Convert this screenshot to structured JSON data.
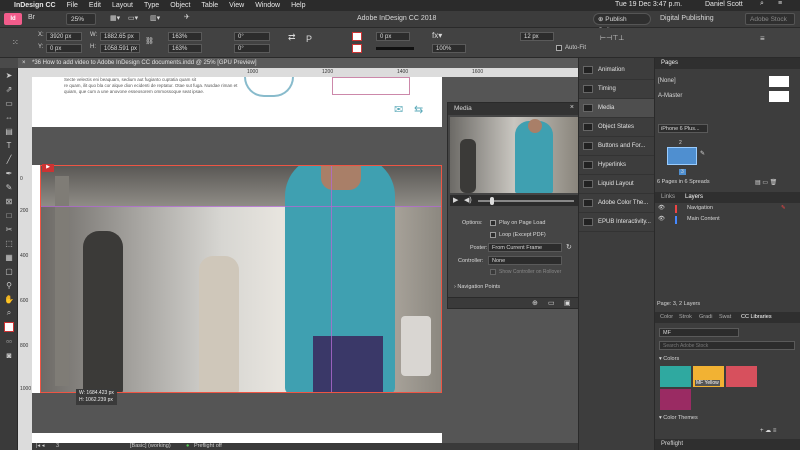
{
  "menubar": {
    "items": [
      "InDesign CC",
      "File",
      "Edit",
      "Layout",
      "Type",
      "Object",
      "Table",
      "View",
      "Window",
      "Help"
    ],
    "clock": "Tue 19 Dec  3:47 p.m.",
    "user": "Daniel Scott"
  },
  "appbar": {
    "zoom": "25%",
    "title": "Adobe InDesign CC 2018",
    "publish": "Publish Online",
    "workspace": "Digital Publishing",
    "search_placeholder": "Adobe Stock"
  },
  "control": {
    "x_label": "X:",
    "x": "3920 px",
    "y_label": "Y:",
    "y": "0 px",
    "w_label": "W:",
    "w": "1882.65 px",
    "h_label": "H:",
    "h": "1058.591 px",
    "scale_x": "163%",
    "scale_y": "163%",
    "angle": "0°",
    "shear": "0°",
    "stroke": "0 px",
    "opacity": "100%",
    "ref": "12 px",
    "autofit": "Auto-Fit"
  },
  "document": {
    "tab": "*36 How to add video to Adobe InDesign CC documents.indd @ 25% [GPU Preview]",
    "ruler_marks": [
      "1000",
      "1200",
      "1400",
      "1600"
    ],
    "vruler_marks": [
      "0",
      "200",
      "400",
      "600",
      "800",
      "1000"
    ],
    "body_text": [
      "Secte velectis eni beaquam, sedium aut fugianto cuptatia quam sit",
      "re quam, ilit quo bla cor alque dion ecidenti de reptatur. Otae sut fuga. Nusdae riman et",
      "quiam, que cum a une anovone esseosorem ommossoque seat ipsae."
    ],
    "size_readout": {
      "w": "W: 1684.423 px",
      "h": "H: 1062.239 px"
    }
  },
  "media_panel": {
    "title": "Media",
    "options_label": "Options:",
    "play_on_load": "Play on Page Load",
    "loop": "Loop (Except PDF)",
    "poster_label": "Poster:",
    "poster_value": "From Current Frame",
    "controller_label": "Controller:",
    "controller_value": "None",
    "show_controller": "Show Controller on Rollover",
    "nav_points": "Navigation Points"
  },
  "side_list": [
    "Animation",
    "Timing",
    "Media",
    "Object States",
    "Buttons and For...",
    "Hyperlinks",
    "Liquid Layout",
    "Adobe Color The...",
    "EPUB Interactivity..."
  ],
  "pages_panel": {
    "title": "Pages",
    "none": "[None]",
    "master": "A-Master",
    "device": "iPhone 6 Plus...",
    "page_num": "2",
    "page_num2": "3",
    "summary": "6 Pages in 6 Spreads"
  },
  "layers_panel": {
    "tab_links": "Links",
    "tab_layers": "Layers",
    "layers": [
      "Navigation",
      "Main Content"
    ],
    "summary": "Page: 3, 2 Layers"
  },
  "cc_panel": {
    "tabs": [
      "Color",
      "Strok",
      "Gradi",
      "Swat",
      "CC Libraries"
    ],
    "library": "MF",
    "search_placeholder": "Search Adobe Stock",
    "colors_label": "Colors",
    "swatches": [
      "#2fa9a0",
      "#f2b233",
      "#d7505d",
      "#9a2b63"
    ],
    "swatch_name": "MF Yellow",
    "themes_label": "Color Themes",
    "preflight": "Preflight"
  },
  "status": {
    "page": "3",
    "style": "[Basic] (working)",
    "preflight": "Preflight off"
  }
}
